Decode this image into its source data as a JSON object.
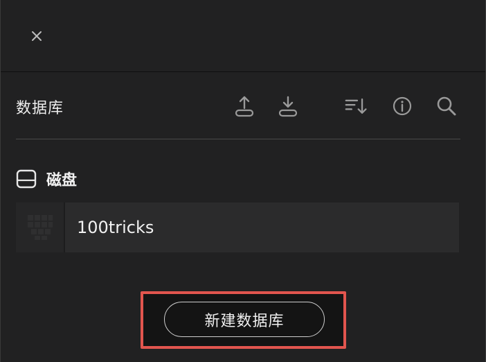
{
  "header": {
    "title": "数据库"
  },
  "toolbar": {
    "icons": [
      "upload-icon",
      "download-icon",
      "sort-icon",
      "info-icon",
      "search-icon"
    ]
  },
  "section": {
    "label": "磁盘",
    "icon": "disk-icon"
  },
  "databases": [
    {
      "name": "100tricks"
    }
  ],
  "actions": {
    "new_database_label": "新建数据库"
  },
  "colors": {
    "background": "#212122",
    "row_background": "#2b2b2c",
    "highlight_border": "#e2554e",
    "icon": "#9a9a9a"
  }
}
